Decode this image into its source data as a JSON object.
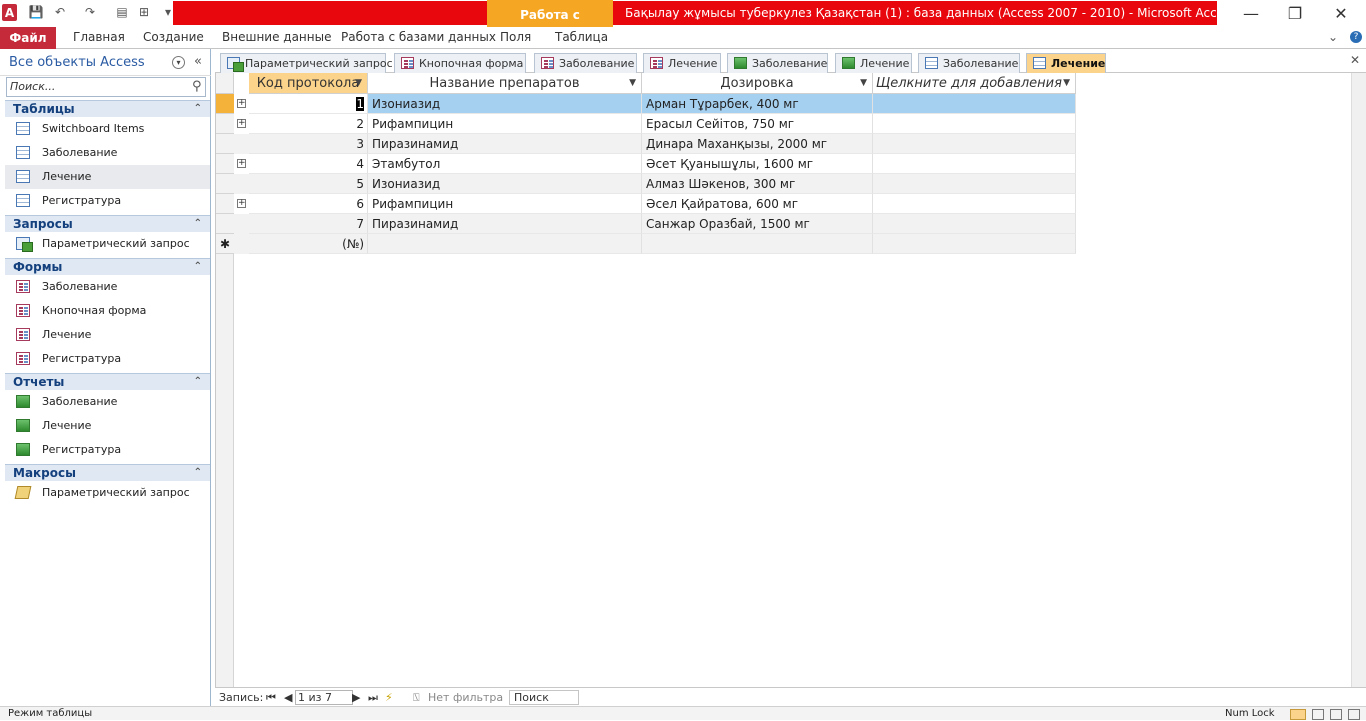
{
  "window": {
    "title": "Бақылау жұмысы туберкулез Қазақстан (1) : база данных (Access 2007 - 2010)  -  Microsoft Access (Сбой а...",
    "context_tab": "Работа с таблицами",
    "minimize": "—",
    "restore": "❐",
    "close": "✕"
  },
  "ribbon": {
    "file": "Файл",
    "tabs": [
      "Главная",
      "Создание",
      "Внешние данные",
      "Работа с базами данных",
      "Поля",
      "Таблица"
    ],
    "help": "?",
    "collapse": "⌄"
  },
  "nav_pane": {
    "title": "Все объекты Access",
    "search_placeholder": "Поиск...",
    "groups": [
      {
        "label": "Таблицы",
        "items": [
          "Switchboard Items",
          "Заболевание",
          "Лечение",
          "Регистратура"
        ]
      },
      {
        "label": "Запросы",
        "items": [
          "Параметрический запрос"
        ]
      },
      {
        "label": "Формы",
        "items": [
          "Заболевание",
          "Кнопочная форма",
          "Лечение",
          "Регистратура"
        ]
      },
      {
        "label": "Отчеты",
        "items": [
          "Заболевание",
          "Лечение",
          "Регистратура"
        ]
      },
      {
        "label": "Макросы",
        "items": [
          "Параметрический запрос"
        ]
      }
    ]
  },
  "doc_tabs": [
    "Параметрический запрос",
    "Кнопочная форма",
    "Заболевание",
    "Лечение",
    "Заболевание",
    "Лечение",
    "Заболевание",
    "Лечение"
  ],
  "table": {
    "columns": [
      "Код протокола",
      "Название препаратов",
      "Дозировка",
      "Щелкните для добавления"
    ],
    "rows": [
      [
        "1",
        "Изониазид",
        "Арман Тұрарбек, 400 мг"
      ],
      [
        "2",
        "Рифампицин",
        "Ерасыл Сейітов, 750 мг"
      ],
      [
        "3",
        "Пиразинамид",
        "Динара Маханқызы, 2000 мг"
      ],
      [
        "4",
        "Этамбутол",
        "Әсет Қуанышұлы, 1600 мг"
      ],
      [
        "5",
        "Изониазид",
        "Алмаз Шәкенов, 300 мг"
      ],
      [
        "6",
        "Рифампицин",
        "Әсел Қайратова, 600 мг"
      ],
      [
        "7",
        "Пиразинамид",
        "Санжар Оразбай, 1500 мг"
      ]
    ],
    "new_row": "(№)"
  },
  "record_nav": {
    "label": "Запись:",
    "position": "1 из 7",
    "filter": "Нет фильтра",
    "search": "Поиск"
  },
  "status": {
    "mode": "Режим таблицы",
    "numlock": "Num Lock"
  },
  "colors": {
    "file_tab": "#c52a3b",
    "title_red": "#e8070d",
    "context_orange": "#f5a623",
    "selected_row": "#a6d0f0"
  }
}
